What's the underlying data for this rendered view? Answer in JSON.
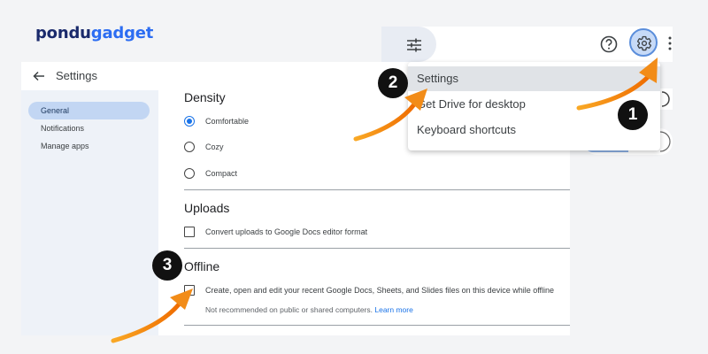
{
  "brand": {
    "logo_part1": "pondu",
    "logo_part2": "gadget"
  },
  "header": {
    "title": "Settings"
  },
  "sidebar": {
    "items": [
      {
        "label": "General"
      },
      {
        "label": "Notifications"
      },
      {
        "label": "Manage apps"
      }
    ]
  },
  "content": {
    "density": {
      "title": "Density",
      "options": [
        {
          "label": "Comfortable",
          "selected": true
        },
        {
          "label": "Cozy",
          "selected": false
        },
        {
          "label": "Compact",
          "selected": false
        }
      ]
    },
    "uploads": {
      "title": "Uploads",
      "option": "Convert uploads to Google Docs editor format"
    },
    "offline": {
      "title": "Offline",
      "option": "Create, open and edit your recent Google Docs, Sheets, and Slides files on this device while offline",
      "note": "Not recommended on public or shared computers.",
      "learn_more": "Learn more"
    }
  },
  "topbar": {
    "icons": [
      "tune-icon",
      "help-icon",
      "gear-icon",
      "more-vert-icon"
    ]
  },
  "menu": {
    "items": [
      {
        "label": "Settings"
      },
      {
        "label": "Get Drive for desktop"
      },
      {
        "label": "Keyboard shortcuts"
      }
    ]
  },
  "badges": [
    "1",
    "2",
    "3"
  ],
  "colors": {
    "accent": "#1a73e8",
    "arrow": "#f7931e",
    "badge": "#111111"
  }
}
